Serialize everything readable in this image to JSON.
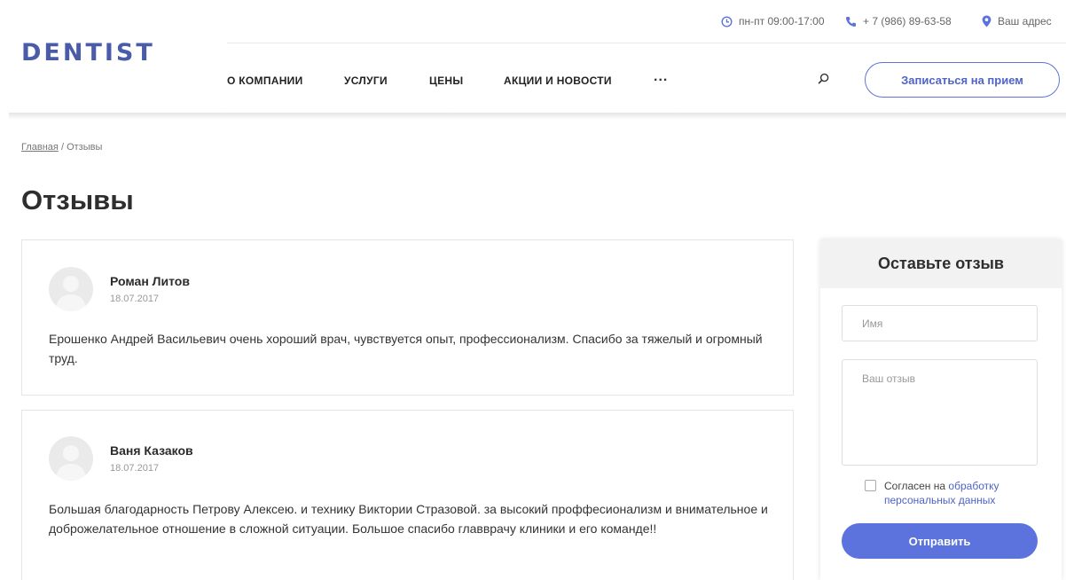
{
  "header": {
    "logo": "DENTIST",
    "hours": "пн-пт 09:00-17:00",
    "phone": "+ 7 (986) 89-63-58",
    "address": "Ваш адрес",
    "nav": [
      "О КОМПАНИИ",
      "УСЛУГИ",
      "ЦЕНЫ",
      "АКЦИИ И НОВОСТИ"
    ],
    "nav_more": "...",
    "cta_label": "Записаться на прием",
    "accent_color": "#5c73dd",
    "logo_color": "#4a5ba8"
  },
  "breadcrumb": {
    "home": "Главная",
    "separator": "/",
    "current": "Отзывы"
  },
  "page_title": "Отзывы",
  "reviews": [
    {
      "name": "Роман Литов",
      "date": "18.07.2017",
      "text": "Ерошенко Андрей Васильевич очень хороший врач, чувствуется опыт, профессионализм. Спасибо за тяжелый и огромный труд."
    },
    {
      "name": "Ваня Казаков",
      "date": "18.07.2017",
      "text": "Большая благодарность Петрову Алексею. и технику Виктории Стразовой. за высокий проффесионализм и внимательное и доброжелательное отношение в сложной ситуации. Большое спасибо главврачу клиники и его команде!!"
    }
  ],
  "form": {
    "title": "Оставьте отзыв",
    "name_placeholder": "Имя",
    "review_placeholder": "Ваш отзыв",
    "consent_prefix": "Согласен на",
    "consent_link": "обработку персональных данных",
    "submit_label": "Отправить"
  },
  "icons": [
    "clock-icon",
    "phone-icon",
    "location-pin-icon",
    "search-icon",
    "user-avatar-icon"
  ]
}
